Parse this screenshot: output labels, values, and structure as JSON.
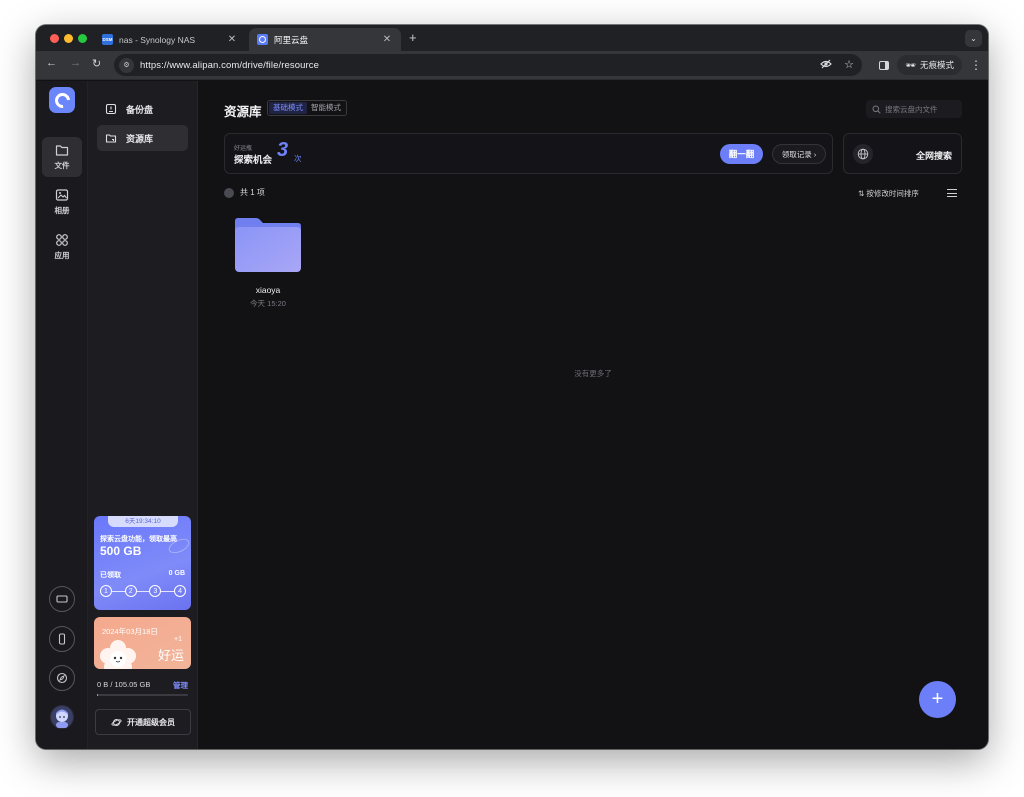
{
  "browser": {
    "tabs": [
      {
        "favicon": "DSM",
        "title": "nas - Synology NAS",
        "active": false
      },
      {
        "favicon": "alipan-logo",
        "title": "阿里云盘",
        "active": true
      }
    ],
    "new_tab": "+",
    "url": "https://www.alipan.com/drive/file/resource",
    "incognito_label": "无痕模式"
  },
  "rail": {
    "items": [
      {
        "label": "文件",
        "icon": "folder-icon",
        "active": true
      },
      {
        "label": "相册",
        "icon": "photo-icon",
        "active": false
      },
      {
        "label": "应用",
        "icon": "apps-icon",
        "active": false
      }
    ],
    "bottom_icons": [
      "tv-icon",
      "phone-icon",
      "compass-icon"
    ],
    "avatar": "user-avatar"
  },
  "subnav": {
    "items": [
      {
        "label": "备份盘",
        "icon": "backup-drive-icon",
        "active": false
      },
      {
        "label": "资源库",
        "icon": "resource-folder-icon",
        "active": true
      }
    ]
  },
  "promo": {
    "timer": "6天19:34:10",
    "line1": "探索云盘功能，领取最高",
    "line2": "500 GB",
    "got_label": "已领取",
    "got_value": "0 GB",
    "steps": [
      "1",
      "2",
      "3",
      "4"
    ]
  },
  "luck": {
    "date": "2024年03月18日",
    "plus": "+1",
    "text": "好运"
  },
  "storage": {
    "used": "0 B / 105.05 GB",
    "manage": "管理",
    "used_fraction": 0.0
  },
  "vip_button": "开通超级会员",
  "main": {
    "title": "资源库",
    "modes": [
      "基础模式",
      "智能模式"
    ],
    "active_mode": "基础模式",
    "search_placeholder": "搜索云盘内文件",
    "explore": {
      "small": "好运瓶",
      "label": "探索机会",
      "count": "3",
      "unit": "次",
      "flip_button": "翻一翻",
      "record_button": "领取记录",
      "record_chevron": "›"
    },
    "global_search": "全网搜索",
    "count_text": "共 1 项",
    "sort_label": "按修改时间排序",
    "files": [
      {
        "name": "xiaoya",
        "time": "今天 15:20",
        "type": "folder"
      }
    ],
    "no_more": "没有更多了",
    "fab": "+"
  },
  "colors": {
    "accent": "#6d7ff8",
    "background": "#121215",
    "sidebar": "#1d1d21"
  }
}
